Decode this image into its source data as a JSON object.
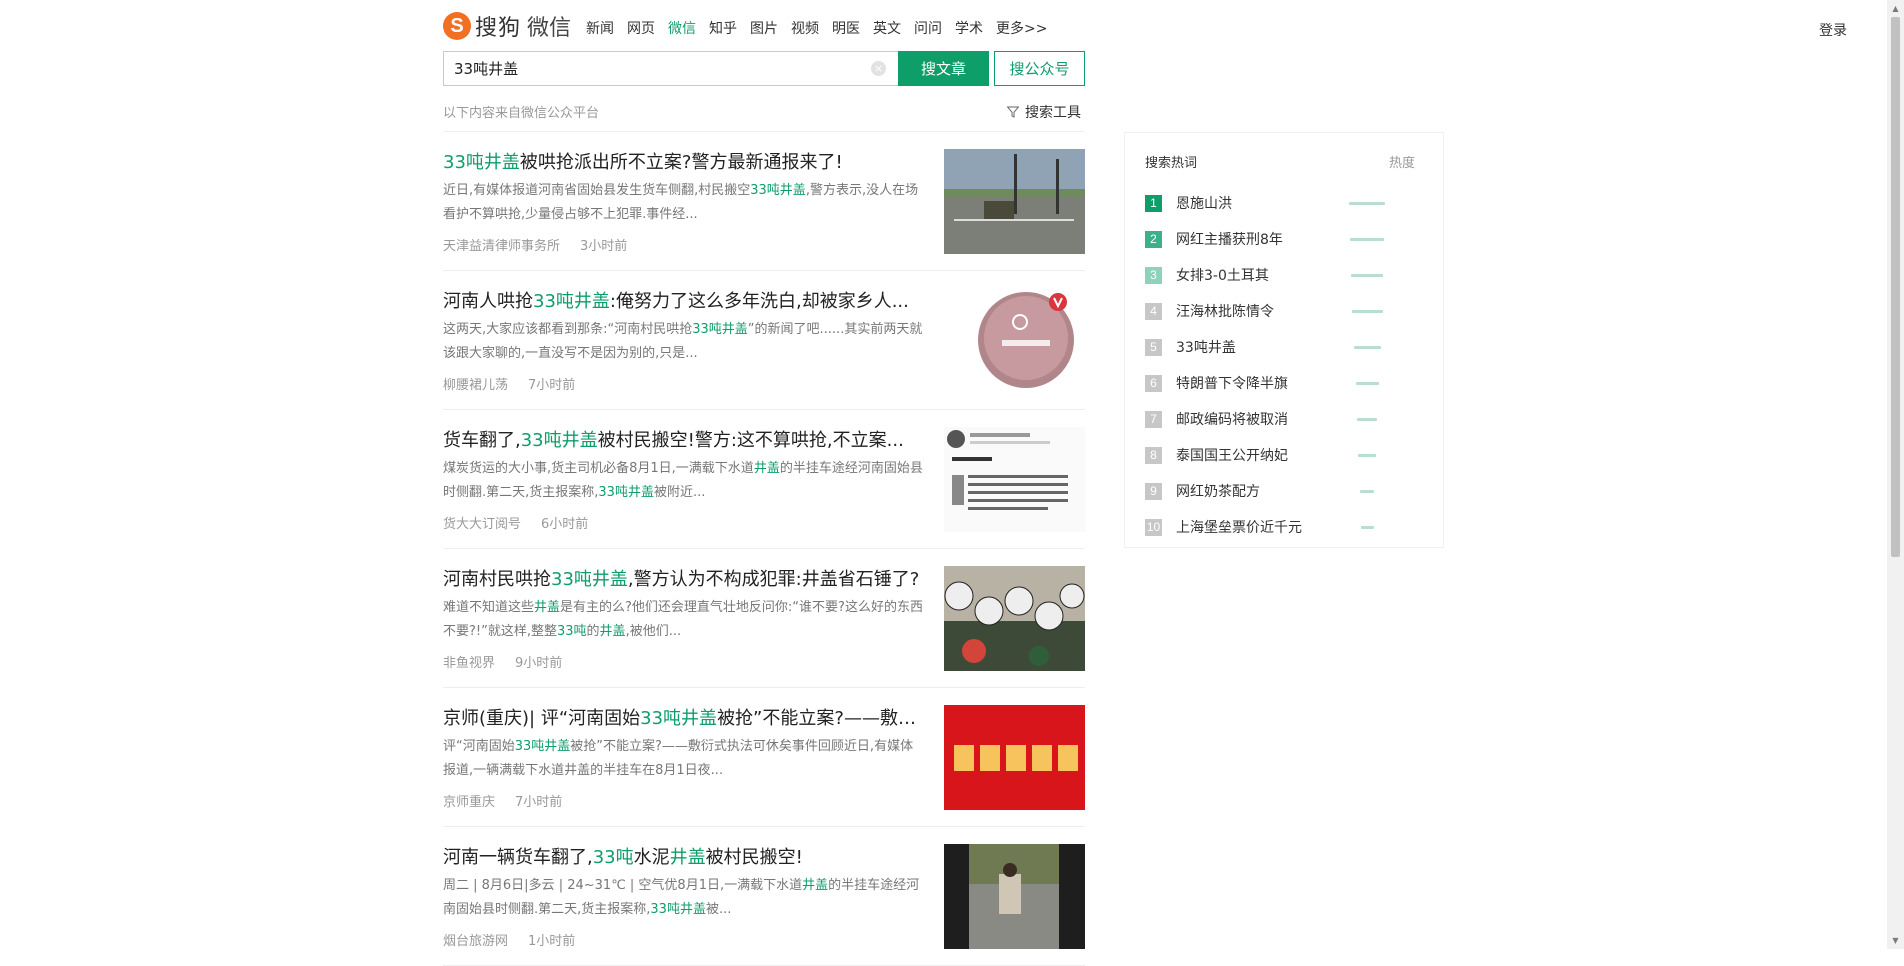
{
  "header": {
    "logo_letter": "S",
    "logo_text": "搜狗",
    "logo_sub": "微信",
    "nav": [
      "新闻",
      "网页",
      "微信",
      "知乎",
      "图片",
      "视频",
      "明医",
      "英文",
      "问问",
      "学术",
      "更多>>"
    ],
    "active_nav_index": 2,
    "login": "登录"
  },
  "search": {
    "query": "33吨井盖",
    "clear_symbol": "×",
    "btn_article": "搜文章",
    "btn_account": "搜公众号"
  },
  "results_header": {
    "source_note": "以下内容来自微信公众平台",
    "tools": "搜索工具"
  },
  "results": [
    {
      "title": [
        {
          "t": "33吨井盖",
          "h": true
        },
        {
          "t": "被哄抢派出所不立案?警方最新通报来了!",
          "h": false
        }
      ],
      "desc": [
        {
          "t": "近日,有媒体报道河南省固始县发生货车侧翻,村民搬空",
          "h": false
        },
        {
          "t": "33吨井盖",
          "h": true
        },
        {
          "t": ",警方表示,没人在场看护不算哄抢,少量侵占够不上犯罪.事件经...",
          "h": false
        }
      ],
      "source": "天津益清律师事务所",
      "time": "3小时前",
      "thumb": "road-photo"
    },
    {
      "title": [
        {
          "t": "河南人哄抢",
          "h": false
        },
        {
          "t": "33吨井盖",
          "h": true
        },
        {
          "t": ":俺努力了这么多年洗白,却被家乡人...",
          "h": false
        }
      ],
      "desc": [
        {
          "t": "这两天,大家应该都看到那条:“河南村民哄抢",
          "h": false
        },
        {
          "t": "33吨井盖",
          "h": true
        },
        {
          "t": "”的新闻了吧......其实前两天就该跟大家聊的,一直没写不是因为别的,只是...",
          "h": false
        }
      ],
      "source": "柳腰裙儿荡",
      "time": "7小时前",
      "thumb": "avatar-badge"
    },
    {
      "title": [
        {
          "t": "货车翻了,",
          "h": false
        },
        {
          "t": "33吨井盖",
          "h": true
        },
        {
          "t": "被村民搬空!警方:这不算哄抢,不立案...",
          "h": false
        }
      ],
      "desc": [
        {
          "t": "煤炭货运的大小事,货主司机必备8月1日,一满载下水道",
          "h": false
        },
        {
          "t": "井盖",
          "h": true
        },
        {
          "t": "的半挂车途经河南固始县时侧翻.第二天,货主报案称,",
          "h": false
        },
        {
          "t": "33吨井盖",
          "h": true
        },
        {
          "t": "被附近...",
          "h": false
        }
      ],
      "source": "货大大订阅号",
      "time": "6小时前",
      "thumb": "weibo-screenshot"
    },
    {
      "title": [
        {
          "t": "河南村民哄抢",
          "h": false
        },
        {
          "t": "33吨井盖",
          "h": true
        },
        {
          "t": ",警方认为不构成犯罪:井盖省石锤了?",
          "h": false
        }
      ],
      "desc": [
        {
          "t": "难道不知道这些",
          "h": false
        },
        {
          "t": "井盖",
          "h": true
        },
        {
          "t": "是有主的么?他们还会理直气壮地反问你:“谁不要?这么好的东西不要?!”就这样,整整",
          "h": false
        },
        {
          "t": "33吨",
          "h": true
        },
        {
          "t": "的",
          "h": false
        },
        {
          "t": "井盖",
          "h": true
        },
        {
          "t": ",被他们...",
          "h": false
        }
      ],
      "source": "非鱼视界",
      "time": "9小时前",
      "thumb": "crowd-signs"
    },
    {
      "title": [
        {
          "t": "京师(重庆)| 评“河南固始",
          "h": false
        },
        {
          "t": "33吨井盖",
          "h": true
        },
        {
          "t": "被抢”不能立案?——敷衍式执法可休矣",
          "h": false
        }
      ],
      "desc": [
        {
          "t": "评“河南固始",
          "h": false
        },
        {
          "t": "33吨井盖",
          "h": true
        },
        {
          "t": "被抢”不能立案?——敷衍式执法可休矣事件回顾近日,有媒体报道,一辆满载下水道井盖的半挂车在8月1日夜...",
          "h": false
        }
      ],
      "source": "京师重庆",
      "time": "7小时前",
      "thumb": "red-banner"
    },
    {
      "title": [
        {
          "t": "河南一辆货车翻了,",
          "h": false
        },
        {
          "t": "33吨",
          "h": true
        },
        {
          "t": "水泥",
          "h": false
        },
        {
          "t": "井盖",
          "h": true
        },
        {
          "t": "被村民搬空!",
          "h": false
        }
      ],
      "desc": [
        {
          "t": "周二 | 8月6日|多云 | 24~31℃ | 空气优8月1日,一满载下水道",
          "h": false
        },
        {
          "t": "井盖",
          "h": true
        },
        {
          "t": "的半挂车途经河南固始县时侧翻.第二天,货主报案称,",
          "h": false
        },
        {
          "t": "33吨井盖",
          "h": true
        },
        {
          "t": "被...",
          "h": false
        }
      ],
      "source": "烟台旅游网",
      "time": "1小时前",
      "thumb": "field-photo"
    }
  ],
  "hot": {
    "title": "搜索热词",
    "heat_label": "热度",
    "items": [
      {
        "rank": "1",
        "text": "恩施山洪",
        "color": "#0e9e6a",
        "heat": 1.0
      },
      {
        "rank": "2",
        "text": "网红主播获刑8年",
        "color": "#3bb08a",
        "heat": 0.95
      },
      {
        "rank": "3",
        "text": "女排3-0土耳其",
        "color": "#8fd1bb",
        "heat": 0.9
      },
      {
        "rank": "4",
        "text": "汪海林批陈情令",
        "color": "#c7c7c7",
        "heat": 0.85
      },
      {
        "rank": "5",
        "text": "33吨井盖",
        "color": "#c7c7c7",
        "heat": 0.75
      },
      {
        "rank": "6",
        "text": "特朗普下令降半旗",
        "color": "#c7c7c7",
        "heat": 0.65
      },
      {
        "rank": "7",
        "text": "邮政编码将被取消",
        "color": "#c7c7c7",
        "heat": 0.55
      },
      {
        "rank": "8",
        "text": "泰国国王公开纳妃",
        "color": "#c7c7c7",
        "heat": 0.5
      },
      {
        "rank": "9",
        "text": "网红奶茶配方",
        "color": "#c7c7c7",
        "heat": 0.4
      },
      {
        "rank": "10",
        "text": "上海堡垒票价近千元",
        "color": "#c7c7c7",
        "heat": 0.35
      }
    ]
  },
  "colors": {
    "brand": "#0e9e6a",
    "logo": "#f36f21"
  }
}
